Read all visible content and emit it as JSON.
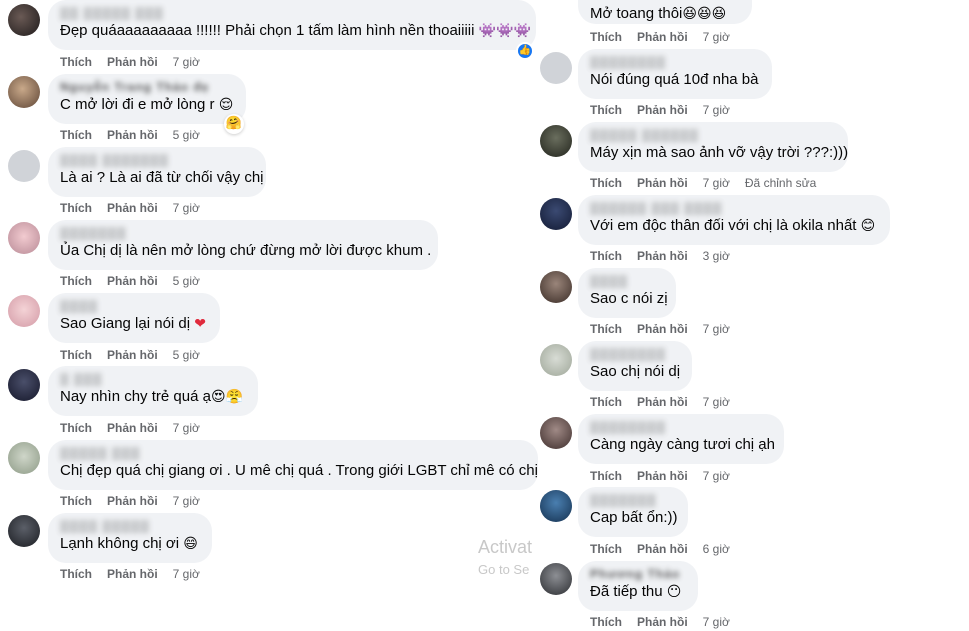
{
  "labels": {
    "like": "Thích",
    "reply": "Phản hồi",
    "edited": "Đã chỉnh sửa"
  },
  "left_comments": [
    {
      "name": "▒▒ ▒▒▒▒▒ ▒▒▒",
      "text": "Đẹp quáaaaaaaaaa !!!!!! Phải chọn 1 tấm làm hình nền thoaiiiii",
      "emoji": "👾👾👾",
      "time": "7 giờ",
      "reaction": "👍"
    },
    {
      "name": "Nguyễn Trang Thảo đẹ",
      "text": "C mở lời đi e mở lòng r",
      "emoji": "😌",
      "time": "5 giờ",
      "reaction": "🤗"
    },
    {
      "name": "▒▒▒▒ ▒▒▒▒▒▒▒",
      "text": "Là ai ? Là ai đã từ chối vậy chị",
      "emoji": "",
      "time": "7 giờ"
    },
    {
      "name": "▒▒▒▒▒▒▒",
      "text": "Ủa Chị dị là nên mở lòng chứ đừng mở lời được khum .",
      "emoji": "",
      "time": "5 giờ"
    },
    {
      "name": "▒▒▒▒",
      "text": "Sao Giang lại nói dị",
      "emoji": "❤",
      "time": "5 giờ"
    },
    {
      "name": "▒ ▒▒▒",
      "text": "Nay nhìn chy trẻ quá ạ",
      "emoji": "😍😤",
      "time": "7 giờ"
    },
    {
      "name": "▒▒▒▒▒ ▒▒▒",
      "text": "Chị đẹp quá chị giang ơi . U mê chị quá . Trong giới LGBT chỉ mê có chị",
      "emoji": "",
      "time": "7 giờ"
    },
    {
      "name": "▒▒▒▒ ▒▒▒▒▒",
      "text": "Lạnh không chị ơi",
      "emoji": "😄",
      "time": "7 giờ"
    }
  ],
  "right_comments": [
    {
      "name": "",
      "text": "Mở toang thôi",
      "emoji": "😆😆😆",
      "time": "7 giờ"
    },
    {
      "name": "▒▒▒▒▒▒▒▒",
      "text": "Nói đúng quá 10đ nha bà",
      "emoji": "",
      "time": "7 giờ"
    },
    {
      "name": "▒▒▒▒▒ ▒▒▒▒▒▒",
      "text": "Máy xịn mà sao ảnh vỡ vậy trời ???:)))",
      "emoji": "",
      "time": "7 giờ",
      "edited": true
    },
    {
      "name": "▒▒▒▒▒▒ ▒▒▒ ▒▒▒▒",
      "text": "Với em độc thân đối với chị là okila nhất",
      "emoji": "😊",
      "time": "3 giờ"
    },
    {
      "name": "▒▒▒▒",
      "text": "Sao c nói zị",
      "emoji": "",
      "time": "7 giờ"
    },
    {
      "name": "▒▒▒▒▒▒▒▒",
      "text": "Sao chị nói dị",
      "emoji": "",
      "time": "7 giờ"
    },
    {
      "name": "▒▒▒▒▒▒▒▒",
      "text": "Càng ngày càng tươi chị ạh",
      "emoji": "",
      "time": "7 giờ"
    },
    {
      "name": "▒▒▒▒▒▒▒",
      "text": "Cap bất ổn:))",
      "emoji": "",
      "time": "6 giờ"
    },
    {
      "name": "Phương Thảo",
      "text": "Đã tiếp thu",
      "emoji": "😶",
      "time": "7 giờ"
    }
  ],
  "watermark": {
    "line1": "Activat",
    "line2": "Go to Se"
  },
  "colors": {
    "bubble": "#f0f2f5",
    "meta": "#65676b",
    "like_badge": "#1877f2"
  }
}
